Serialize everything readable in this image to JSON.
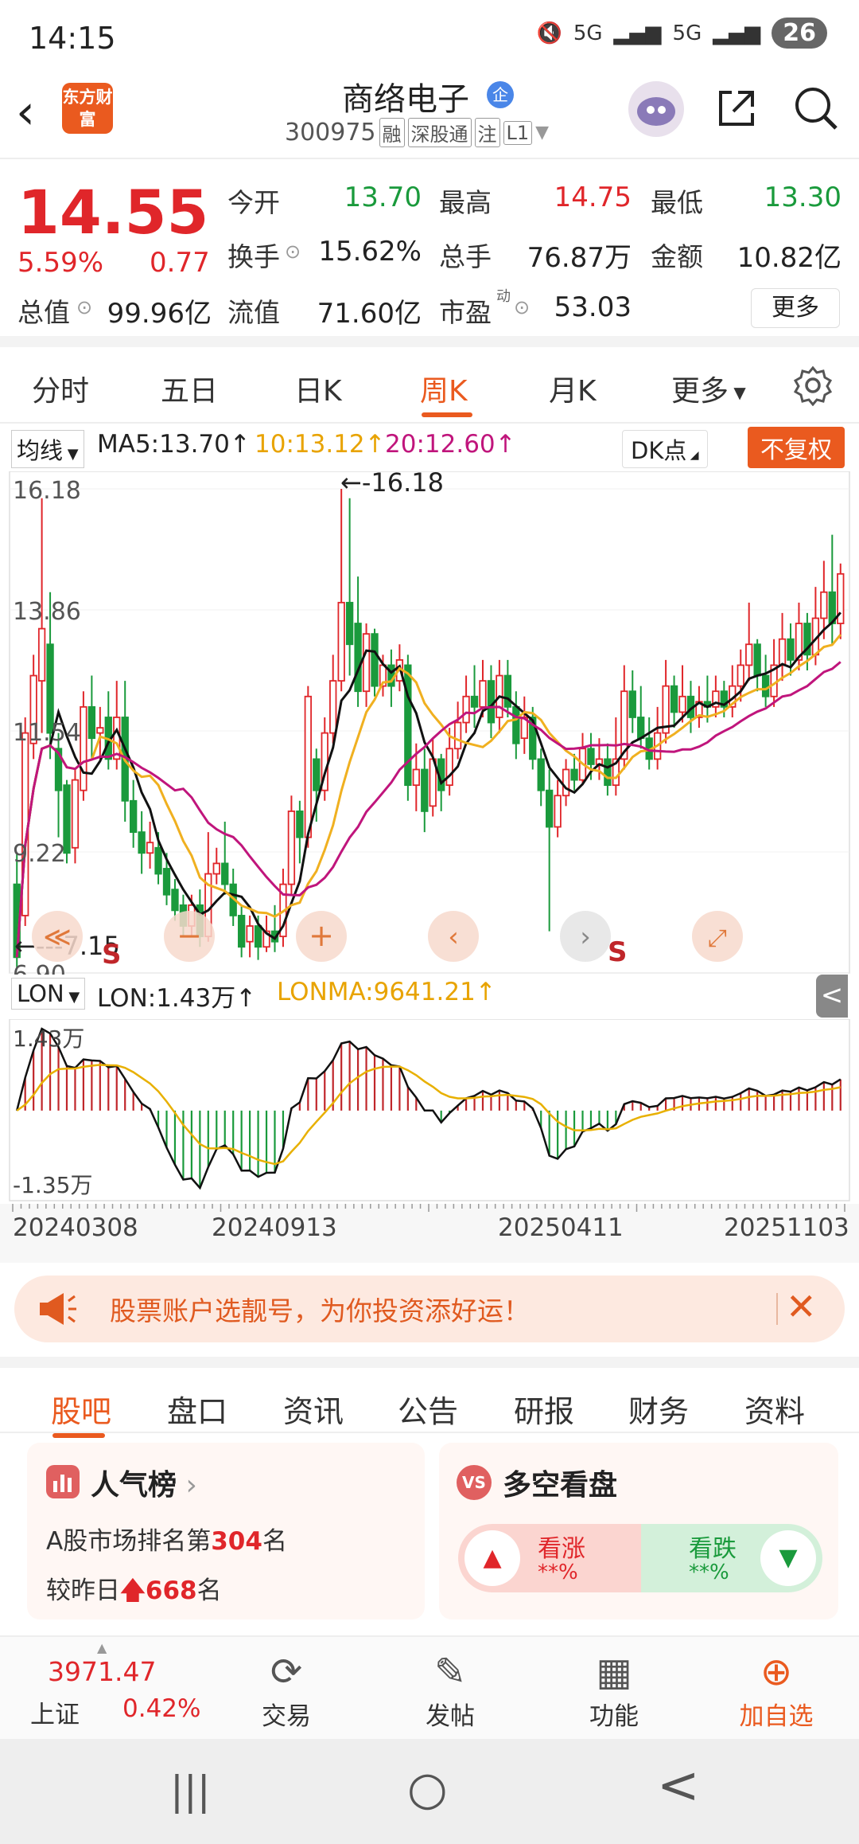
{
  "status_bar": {
    "time": "14:15",
    "signal1": "5G",
    "signal2": "5G",
    "battery": "26"
  },
  "header": {
    "logo_text": "东方财富",
    "stock_name": "商络电子",
    "badge": "企",
    "stock_code": "300975",
    "tags": [
      "融",
      "深股通",
      "注",
      "L1"
    ]
  },
  "quote": {
    "price": "14.55",
    "change_pct": "5.59%",
    "change_val": "0.77",
    "open_label": "今开",
    "open": "13.70",
    "high_label": "最高",
    "high": "14.75",
    "low_label": "最低",
    "low": "13.30",
    "turnover_label": "换手",
    "turnover": "15.62%",
    "volume_label": "总手",
    "volume": "76.87万",
    "amount_label": "金额",
    "amount": "10.82亿",
    "mktcap_label": "总值",
    "mktcap": "99.96亿",
    "float_label": "流值",
    "float": "71.60亿",
    "pe_label": "市盈",
    "pe_sup": "动",
    "pe": "53.03",
    "more": "更多"
  },
  "period_tabs": {
    "items": [
      "分时",
      "五日",
      "日K",
      "周K",
      "月K",
      "更多"
    ],
    "active": "周K"
  },
  "chart_header": {
    "ma_select": "均线",
    "ma5": "MA5:13.70↑",
    "ma10": "10:13.12↑",
    "ma20": "20:12.60↑",
    "dk": "DK点",
    "fq": "不复权"
  },
  "chart_data": {
    "type": "candlestick",
    "y_ticks": [
      "16.18",
      "13.86",
      "11.54",
      "9.22",
      "6.90"
    ],
    "ylim": [
      6.9,
      16.18
    ],
    "max_label": "←-16.18",
    "min_label": "←---7.15",
    "series_colors": {
      "up": "#e0262a",
      "down": "#1a9a3c",
      "ma5": "#111111",
      "ma10": "#f0b020",
      "ma20": "#c0157c"
    },
    "marker_s": "S",
    "candles": [
      [
        8.6,
        7.2,
        9.2,
        7.0
      ],
      [
        8.0,
        11.5,
        11.8,
        7.8
      ],
      [
        11.3,
        12.6,
        13.0,
        11.0
      ],
      [
        12.5,
        13.5,
        16.0,
        11.5
      ],
      [
        13.2,
        11.5,
        14.2,
        11.0
      ],
      [
        11.2,
        10.4,
        11.5,
        9.5
      ],
      [
        10.5,
        9.2,
        10.6,
        9.0
      ],
      [
        9.3,
        10.6,
        10.8,
        9.0
      ],
      [
        10.4,
        12.0,
        12.3,
        10.2
      ],
      [
        12.0,
        11.4,
        12.6,
        11.0
      ],
      [
        11.5,
        11.6,
        12.0,
        11.0
      ],
      [
        11.8,
        11.0,
        12.3,
        10.8
      ],
      [
        11.0,
        11.8,
        12.5,
        10.8
      ],
      [
        11.8,
        10.2,
        12.5,
        9.8
      ],
      [
        10.2,
        9.6,
        10.6,
        9.3
      ],
      [
        9.6,
        9.2,
        10.0,
        8.8
      ],
      [
        9.2,
        9.4,
        9.8,
        8.9
      ],
      [
        9.3,
        8.8,
        9.6,
        8.6
      ],
      [
        8.9,
        8.4,
        9.2,
        8.2
      ],
      [
        8.5,
        8.1,
        8.7,
        7.9
      ],
      [
        8.2,
        7.8,
        8.4,
        7.6
      ],
      [
        7.8,
        8.2,
        8.4,
        7.6
      ],
      [
        8.2,
        7.6,
        8.5,
        7.4
      ],
      [
        7.6,
        8.8,
        9.6,
        7.5
      ],
      [
        8.8,
        9.0,
        9.3,
        8.6
      ],
      [
        9.0,
        8.6,
        9.8,
        8.4
      ],
      [
        8.6,
        8.0,
        8.9,
        7.8
      ],
      [
        8.0,
        7.4,
        8.2,
        7.2
      ],
      [
        7.5,
        7.8,
        8.0,
        7.2
      ],
      [
        7.8,
        7.4,
        8.0,
        7.15
      ],
      [
        7.4,
        7.7,
        8.0,
        7.3
      ],
      [
        7.7,
        7.5,
        8.2,
        7.3
      ],
      [
        7.6,
        8.6,
        8.9,
        7.4
      ],
      [
        8.6,
        10.0,
        10.3,
        8.4
      ],
      [
        10.0,
        9.5,
        10.2,
        9.0
      ],
      [
        9.5,
        12.2,
        12.4,
        9.3
      ],
      [
        11.0,
        10.4,
        11.2,
        9.8
      ],
      [
        10.4,
        11.5,
        11.8,
        10.2
      ],
      [
        11.5,
        12.5,
        13.0,
        11.3
      ],
      [
        12.5,
        14.0,
        16.18,
        12.3
      ],
      [
        14.0,
        13.2,
        16.0,
        12.6
      ],
      [
        13.6,
        12.3,
        14.5,
        12.0
      ],
      [
        12.3,
        13.4,
        13.6,
        12.0
      ],
      [
        13.4,
        12.4,
        13.5,
        12.2
      ],
      [
        12.4,
        12.8,
        13.0,
        12.2
      ],
      [
        12.8,
        12.4,
        13.1,
        12.0
      ],
      [
        12.5,
        12.9,
        13.2,
        12.3
      ],
      [
        12.8,
        10.5,
        13.0,
        10.2
      ],
      [
        10.5,
        10.8,
        11.3,
        10.0
      ],
      [
        10.8,
        10.0,
        11.2,
        9.6
      ],
      [
        10.1,
        11.0,
        11.4,
        9.9
      ],
      [
        11.0,
        10.4,
        11.1,
        10.0
      ],
      [
        10.5,
        11.2,
        11.6,
        10.3
      ],
      [
        11.2,
        11.7,
        12.1,
        11.0
      ],
      [
        11.7,
        12.2,
        12.6,
        11.5
      ],
      [
        12.2,
        12.0,
        12.8,
        11.6
      ],
      [
        12.0,
        12.5,
        12.9,
        11.8
      ],
      [
        12.5,
        11.7,
        12.8,
        11.4
      ],
      [
        11.8,
        12.6,
        12.9,
        11.5
      ],
      [
        12.6,
        12.0,
        12.9,
        11.8
      ],
      [
        12.0,
        11.3,
        12.3,
        11.0
      ],
      [
        11.4,
        11.8,
        12.2,
        11.1
      ],
      [
        11.8,
        11.0,
        12.0,
        10.8
      ],
      [
        11.0,
        10.4,
        11.2,
        10.1
      ],
      [
        10.4,
        9.7,
        10.8,
        7.7
      ],
      [
        9.7,
        10.3,
        10.6,
        9.5
      ],
      [
        10.3,
        10.8,
        11.0,
        10.1
      ],
      [
        10.8,
        10.6,
        11.1,
        10.4
      ],
      [
        10.6,
        11.2,
        11.5,
        10.5
      ],
      [
        11.2,
        10.9,
        11.5,
        10.6
      ],
      [
        10.9,
        11.0,
        11.4,
        10.6
      ],
      [
        11.0,
        10.5,
        11.3,
        10.3
      ],
      [
        10.5,
        11.0,
        11.8,
        10.3
      ],
      [
        11.0,
        12.3,
        12.8,
        10.8
      ],
      [
        12.3,
        11.8,
        12.7,
        11.5
      ],
      [
        11.8,
        11.4,
        12.4,
        11.2
      ],
      [
        11.4,
        11.0,
        11.8,
        10.8
      ],
      [
        11.0,
        11.5,
        12.0,
        10.8
      ],
      [
        11.5,
        12.4,
        12.9,
        11.3
      ],
      [
        12.4,
        11.9,
        12.6,
        11.6
      ],
      [
        11.9,
        12.2,
        12.8,
        11.7
      ],
      [
        12.2,
        11.8,
        12.5,
        11.5
      ],
      [
        11.8,
        12.1,
        12.4,
        11.6
      ],
      [
        12.1,
        12.0,
        12.6,
        11.7
      ],
      [
        12.0,
        12.3,
        12.6,
        11.8
      ],
      [
        12.3,
        12.0,
        12.5,
        11.8
      ],
      [
        12.0,
        12.4,
        12.8,
        11.8
      ],
      [
        12.4,
        12.8,
        13.1,
        12.1
      ],
      [
        12.8,
        13.2,
        14.0,
        12.5
      ],
      [
        13.2,
        12.6,
        13.3,
        12.3
      ],
      [
        12.6,
        12.2,
        13.0,
        12.0
      ],
      [
        12.2,
        12.8,
        13.3,
        12.0
      ],
      [
        12.8,
        13.3,
        13.8,
        12.5
      ],
      [
        13.3,
        12.9,
        13.6,
        12.6
      ],
      [
        12.9,
        13.6,
        14.0,
        12.7
      ],
      [
        13.6,
        13.0,
        13.8,
        12.7
      ],
      [
        13.0,
        13.7,
        14.3,
        12.8
      ],
      [
        13.7,
        14.2,
        14.8,
        13.3
      ],
      [
        14.2,
        13.6,
        15.3,
        13.2
      ],
      [
        13.6,
        14.55,
        14.75,
        13.3
      ]
    ]
  },
  "lon_header": {
    "select": "LON",
    "lon": "LON:1.43万↑",
    "lonma": "LONMA:9641.21↑",
    "collapse": "<"
  },
  "lon_chart": {
    "ticks": [
      "1.43万",
      "-1.35万"
    ],
    "range": [
      -1.35,
      1.43
    ]
  },
  "dates": [
    "20240308",
    "20240913",
    "20250411",
    "20251103"
  ],
  "banner": {
    "text": "股票账户选靓号，为你投资添好运！",
    "close": "✕"
  },
  "bottom_tabs": {
    "items": [
      "股吧",
      "盘口",
      "资讯",
      "公告",
      "研报",
      "财务",
      "资料"
    ],
    "active": "股吧"
  },
  "popularity": {
    "title": "人气榜",
    "rank_prefix": "A股市场排名第",
    "rank": "304",
    "rank_suffix": "名",
    "change_prefix": "较昨日",
    "change": "668",
    "change_suffix": "名"
  },
  "sentiment": {
    "title": "多空看盘",
    "bull_label": "看涨",
    "bull_val": "**%",
    "bear_label": "看跌",
    "bear_val": "**%"
  },
  "bottom_bar": {
    "index_value": "3971.47",
    "index_name": "上证",
    "index_pct": "0.42%",
    "trade": "交易",
    "post": "发帖",
    "func": "功能",
    "watch": "加自选"
  },
  "system_nav": {
    "recent": "|||",
    "home": "○",
    "back": "<"
  }
}
